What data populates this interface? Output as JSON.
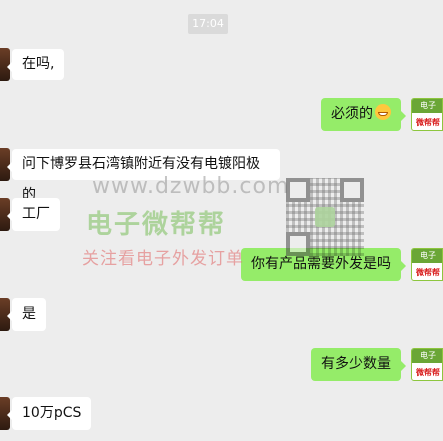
{
  "chat": {
    "timestamp": "17:04",
    "messages": [
      {
        "side": "left",
        "text": "在吗,"
      },
      {
        "side": "right",
        "text": "必须的",
        "emoji": "grin-emoji"
      },
      {
        "side": "left",
        "text": "问下博罗县石湾镇附近有没有电镀阳极的"
      },
      {
        "side": "left",
        "text": "工厂"
      },
      {
        "side": "right",
        "text": "你有产品需要外发是吗"
      },
      {
        "side": "left",
        "text": "是"
      },
      {
        "side": "right",
        "text": "有多少数量"
      },
      {
        "side": "left",
        "text": "10万pCS"
      }
    ]
  },
  "avatar_self": {
    "line1": "电子",
    "line2": "微帮帮"
  },
  "watermark": {
    "url": "www.dzwbb.com",
    "name": "电子微帮帮",
    "slogan": "关注看电子外发订单",
    "qr_icon": "qr-code-icon"
  }
}
